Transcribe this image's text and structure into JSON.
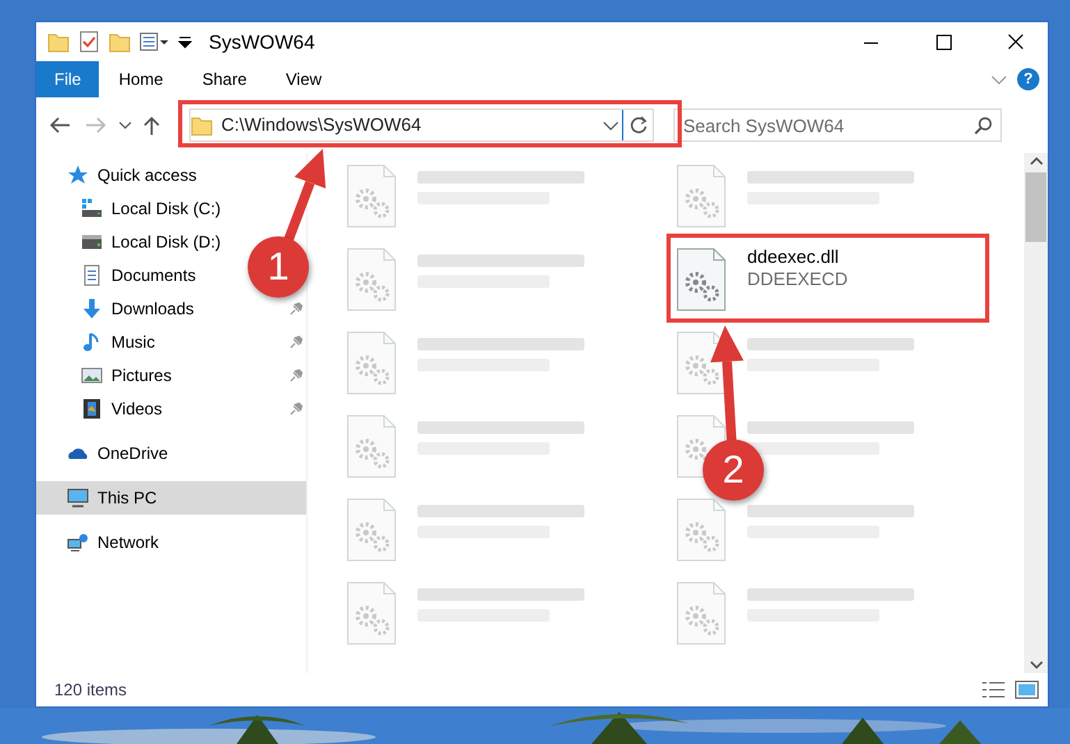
{
  "window": {
    "title": "SysWOW64"
  },
  "ribbon_tabs": [
    {
      "label": "File",
      "selected": true
    },
    {
      "label": "Home",
      "selected": false
    },
    {
      "label": "Share",
      "selected": false
    },
    {
      "label": "View",
      "selected": false
    }
  ],
  "help": "?",
  "address": {
    "path": "C:\\Windows\\SysWOW64"
  },
  "search": {
    "placeholder": "Search SysWOW64"
  },
  "sidebar": {
    "items": [
      {
        "label": "Quick access",
        "kind": "quick",
        "selected": false,
        "children": [
          {
            "label": "Local Disk (C:)",
            "kind": "disk-c",
            "pinned": false
          },
          {
            "label": "Local Disk (D:)",
            "kind": "disk",
            "pinned": false
          },
          {
            "label": "Documents",
            "kind": "documents",
            "pinned": false
          },
          {
            "label": "Downloads",
            "kind": "downloads",
            "pinned": true
          },
          {
            "label": "Music",
            "kind": "music",
            "pinned": true
          },
          {
            "label": "Pictures",
            "kind": "pictures",
            "pinned": true
          },
          {
            "label": "Videos",
            "kind": "videos",
            "pinned": true
          }
        ]
      },
      {
        "label": "OneDrive",
        "kind": "onedrive",
        "selected": false
      },
      {
        "label": "This PC",
        "kind": "pc",
        "selected": true
      },
      {
        "label": "Network",
        "kind": "network",
        "selected": false
      }
    ]
  },
  "files": [
    {
      "kind": "blurred"
    },
    {
      "kind": "blurred"
    },
    {
      "kind": "blurred"
    },
    {
      "kind": "file",
      "name": "ddeexec.dll",
      "type": "DDEEXECD"
    },
    {
      "kind": "blurred"
    },
    {
      "kind": "blurred"
    },
    {
      "kind": "blurred"
    },
    {
      "kind": "blurred"
    },
    {
      "kind": "blurred"
    },
    {
      "kind": "blurred"
    },
    {
      "kind": "blurred"
    },
    {
      "kind": "blurred"
    }
  ],
  "status_bar": {
    "count": "120 items"
  },
  "annotations": [
    {
      "number": "1"
    },
    {
      "number": "2"
    }
  ]
}
